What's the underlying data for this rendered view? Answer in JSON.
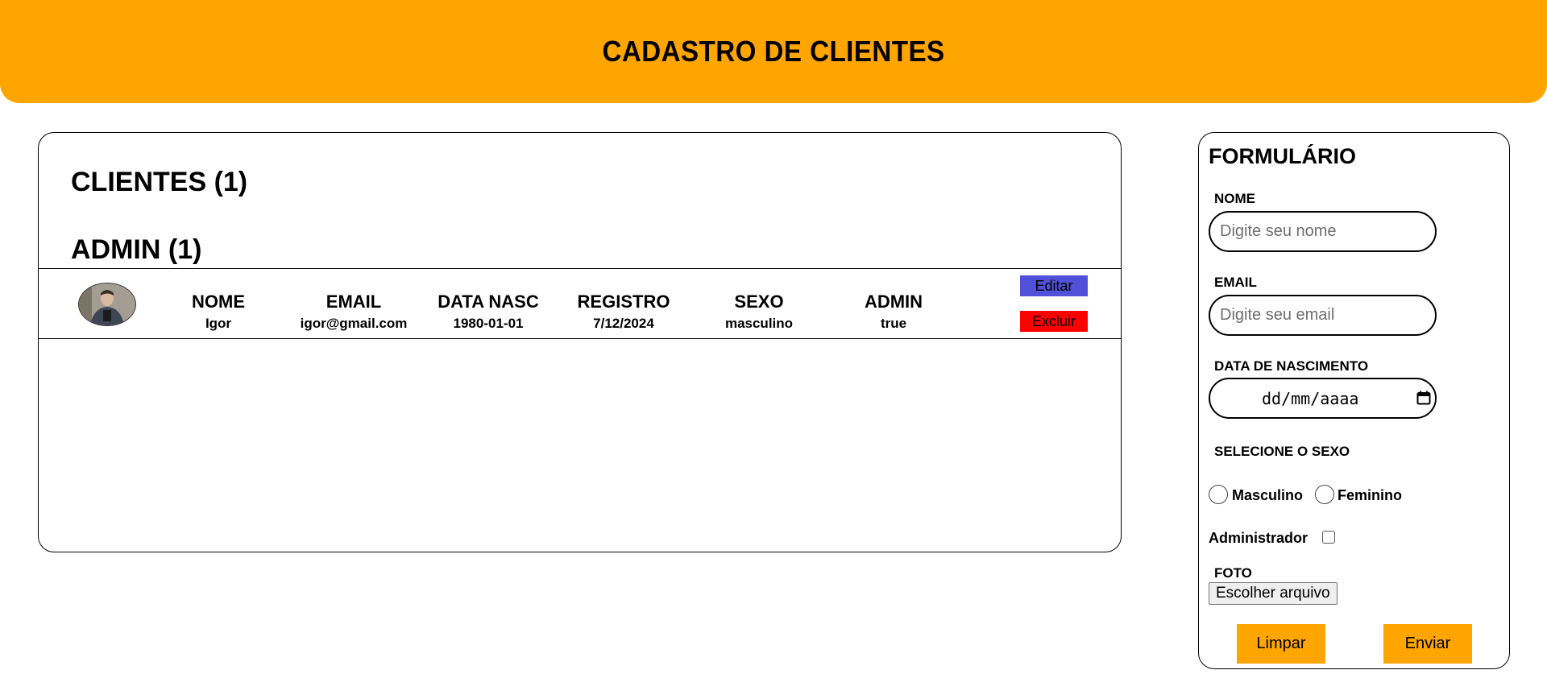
{
  "header": {
    "title": "CADASTRO DE CLIENTES"
  },
  "clients": {
    "title": "CLIENTES (1)",
    "admin_title": "ADMIN (1)",
    "columns": {
      "nome": "NOME",
      "email": "EMAIL",
      "data_nasc": "DATA NASC",
      "registro": "REGISTRO",
      "sexo": "SEXO",
      "admin": "ADMIN"
    },
    "rows": [
      {
        "nome": "Igor",
        "email": "igor@gmail.com",
        "data_nasc": "1980-01-01",
        "registro": "7/12/2024",
        "sexo": "masculino",
        "admin": "true",
        "edit_label": "Editar",
        "delete_label": "Excluir"
      }
    ]
  },
  "form": {
    "title": "FORMULÁRIO",
    "nome_label": "NOME",
    "nome_placeholder": "Digite seu nome",
    "email_label": "EMAIL",
    "email_placeholder": "Digite seu email",
    "data_label": "DATA DE NASCIMENTO",
    "data_placeholder": "dd/mm/aaaa",
    "sexo_label": "SELECIONE O SEXO",
    "sexo_options": [
      "Masculino",
      "Feminino"
    ],
    "admin_label": "Administrador",
    "admin_checked": false,
    "foto_label": "FOTO",
    "file_button": "Escolher arquivo",
    "clear_button": "Limpar",
    "submit_button": "Enviar"
  },
  "colors": {
    "accent": "#ffa500",
    "edit": "#5050d8",
    "delete": "#ff0000"
  }
}
